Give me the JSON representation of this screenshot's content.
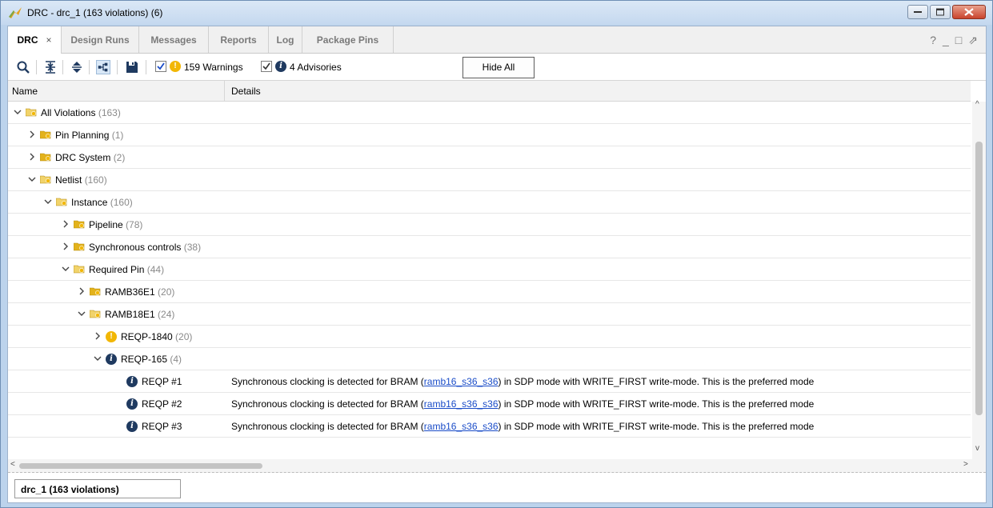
{
  "window": {
    "title": "DRC - drc_1 (163 violations) (6)"
  },
  "tabs": [
    {
      "label": "DRC",
      "active": true,
      "closable": true
    },
    {
      "label": "Design Runs",
      "active": false
    },
    {
      "label": "Messages",
      "active": false
    },
    {
      "label": "Reports",
      "active": false
    },
    {
      "label": "Log",
      "active": false
    },
    {
      "label": "Package Pins",
      "active": false
    }
  ],
  "tab_close_glyph": "×",
  "tab_tools": [
    "?",
    "_",
    "□",
    "⇗"
  ],
  "toolbar": {
    "warnings_label": "159 Warnings",
    "warnings_checked": true,
    "advisories_label": "4 Advisories",
    "advisories_checked": true,
    "hide_all_label": "Hide All",
    "icons": [
      "search-icon",
      "collapse-all-icon",
      "expand-all-icon",
      "group-by-icon",
      "save-icon"
    ]
  },
  "table": {
    "columns": [
      "Name",
      "Details"
    ],
    "rows": [
      {
        "name": "All Violations",
        "count": "(163)",
        "level": 0,
        "expanded": true,
        "icon": "folder-open",
        "details": ""
      },
      {
        "name": "Pin Planning",
        "count": "(1)",
        "level": 1,
        "expanded": false,
        "icon": "folder-closed",
        "details": ""
      },
      {
        "name": "DRC System",
        "count": "(2)",
        "level": 1,
        "expanded": false,
        "icon": "folder-closed",
        "details": ""
      },
      {
        "name": "Netlist",
        "count": "(160)",
        "level": 1,
        "expanded": true,
        "icon": "folder-open",
        "details": ""
      },
      {
        "name": "Instance",
        "count": "(160)",
        "level": 2,
        "expanded": true,
        "icon": "folder-open",
        "details": ""
      },
      {
        "name": "Pipeline",
        "count": "(78)",
        "level": 3,
        "expanded": false,
        "icon": "folder-closed",
        "details": ""
      },
      {
        "name": "Synchronous controls",
        "count": "(38)",
        "level": 3,
        "expanded": false,
        "icon": "folder-closed",
        "details": ""
      },
      {
        "name": "Required Pin",
        "count": "(44)",
        "level": 3,
        "expanded": true,
        "icon": "folder-open",
        "details": ""
      },
      {
        "name": "RAMB36E1",
        "count": "(20)",
        "level": 4,
        "expanded": false,
        "icon": "folder-closed",
        "details": ""
      },
      {
        "name": "RAMB18E1",
        "count": "(24)",
        "level": 4,
        "expanded": true,
        "icon": "folder-open",
        "details": ""
      },
      {
        "name": "REQP-1840",
        "count": "(20)",
        "level": 5,
        "expanded": false,
        "icon": "warning",
        "details": ""
      },
      {
        "name": "REQP-165",
        "count": "(4)",
        "level": 5,
        "expanded": true,
        "icon": "info",
        "details": ""
      },
      {
        "name": "REQP #1",
        "count": "",
        "level": 6,
        "leaf": true,
        "icon": "info",
        "details_pre": "Synchronous clocking is detected for BRAM (",
        "details_link": "ramb16_s36_s36",
        "details_post": ") in SDP mode with WRITE_FIRST write-mode. This is the preferred mode"
      },
      {
        "name": "REQP #2",
        "count": "",
        "level": 6,
        "leaf": true,
        "icon": "info",
        "details_pre": "Synchronous clocking is detected for BRAM (",
        "details_link": "ramb16_s36_s36",
        "details_post": ") in SDP mode with WRITE_FIRST write-mode. This is the preferred mode"
      },
      {
        "name": "REQP #3",
        "count": "",
        "level": 6,
        "leaf": true,
        "icon": "info",
        "details_pre": "Synchronous clocking is detected for BRAM (",
        "details_link": "ramb16_s36_s36",
        "details_post": ") in SDP mode with WRITE_FIRST write-mode. This is the preferred mode"
      }
    ]
  },
  "bottom_tab": {
    "label": "drc_1 (163 violations)"
  },
  "colors": {
    "folder": "#e3b21b",
    "folder_open": "#f1d36a",
    "warning": "#f2b705",
    "info": "#1f3a60",
    "link": "#1a4cc8"
  }
}
